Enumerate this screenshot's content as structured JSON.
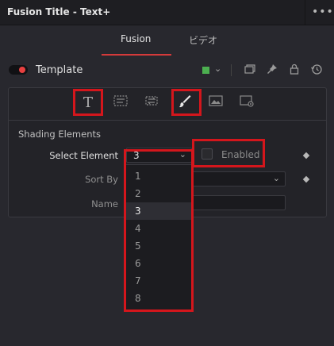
{
  "window": {
    "title": "Fusion Title - Text+",
    "more_label": "•••"
  },
  "tabs": [
    {
      "label": "Fusion",
      "active": true
    },
    {
      "label": "ビデオ",
      "active": false
    }
  ],
  "template_row": {
    "label": "Template",
    "swatch_color": "#4caf50",
    "toggle_color": "#e84040",
    "icons": [
      "window-icon",
      "pin-icon",
      "lock-icon",
      "reset-icon"
    ]
  },
  "toolbar": {
    "tools": [
      "text-tool-icon",
      "layout-tool-icon",
      "transform-tool-icon",
      "shading-tool-icon",
      "image-tool-icon",
      "settings-tool-icon"
    ],
    "text_glyph": "T",
    "highlighted": [
      "text-tool-icon",
      "shading-tool-icon"
    ]
  },
  "shading": {
    "section_title": "Shading Elements",
    "select_element": {
      "label": "Select Element",
      "value": "3"
    },
    "enabled_label": "Enabled",
    "sort_by_label": "Sort By",
    "name_label": "Name"
  },
  "dropdown": {
    "options": [
      "1",
      "2",
      "3",
      "4",
      "5",
      "6",
      "7",
      "8"
    ],
    "selected": "3"
  },
  "colors": {
    "highlight": "#d4161c",
    "tab_accent": "#d33a3a"
  }
}
